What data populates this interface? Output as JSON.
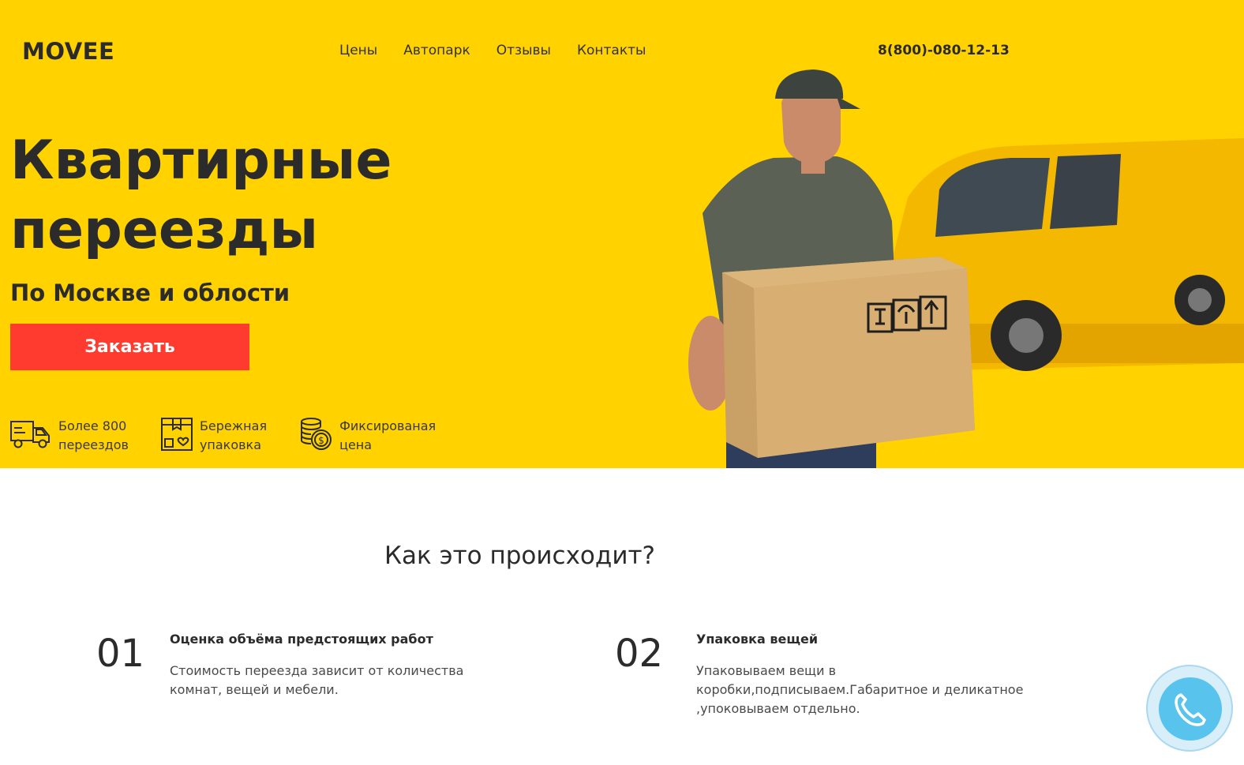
{
  "header": {
    "logo": "MOVEE",
    "nav": [
      "Цены",
      "Автопарк",
      "Отзывы",
      "Контакты"
    ],
    "phone": "8(800)-080-12-13"
  },
  "hero": {
    "title_line1": "Квартирные",
    "title_line2": "переезды",
    "subtitle": "По Москве и облости",
    "cta_label": "Заказать",
    "features": [
      {
        "line1": "Более 800",
        "line2": "переездов",
        "icon": "truck-icon"
      },
      {
        "line1": "Бережная",
        "line2": "упаковка",
        "icon": "package-icon"
      },
      {
        "line1": "Фиксированая",
        "line2": "цена",
        "icon": "coins-icon"
      }
    ]
  },
  "process": {
    "title": "Как это происходит?",
    "steps": [
      {
        "num": "01",
        "title": "Оценка объёма предстоящих работ",
        "desc": "Стоимость переезда зависит от количества комнат, вещей и мебели."
      },
      {
        "num": "02",
        "title": "Упаковка вещей",
        "desc": "Упаковываем вещи в коробки,подписываем.Габаритное и деликатное ,упоковываем отдельно."
      }
    ]
  },
  "colors": {
    "hero_bg": "#ffd200",
    "cta_bg": "#ff3b2f",
    "text_dark": "#2b2b2b",
    "call_widget": "#58c3ec"
  }
}
